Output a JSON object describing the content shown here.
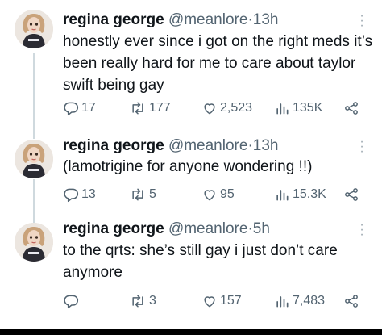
{
  "colors": {
    "text": "#0f1419",
    "secondary": "#536471",
    "thread_line": "#cfd9de"
  },
  "tweets": [
    {
      "name": "regina george",
      "handle": "@meanlore",
      "separator": "·",
      "time": "13h",
      "text": "honestly ever since i got on the right meds it’s been really hard for me to care about taylor swift being gay",
      "replies": "17",
      "reposts": "177",
      "likes": "2,523",
      "views": "135K"
    },
    {
      "name": "regina george",
      "handle": "@meanlore",
      "separator": "·",
      "time": "13h",
      "text": "(lamotrigine for anyone wondering !!)",
      "replies": "13",
      "reposts": "5",
      "likes": "95",
      "views": "15.3K"
    },
    {
      "name": "regina george",
      "handle": "@meanlore",
      "separator": "·",
      "time": "5h",
      "text": "to the qrts: she’s still gay i just don’t care anymore",
      "replies": "",
      "reposts": "3",
      "likes": "157",
      "views": "7,483"
    }
  ],
  "icons": [
    "reply-icon",
    "repost-icon",
    "like-icon",
    "views-icon",
    "share-icon",
    "more-icon"
  ]
}
